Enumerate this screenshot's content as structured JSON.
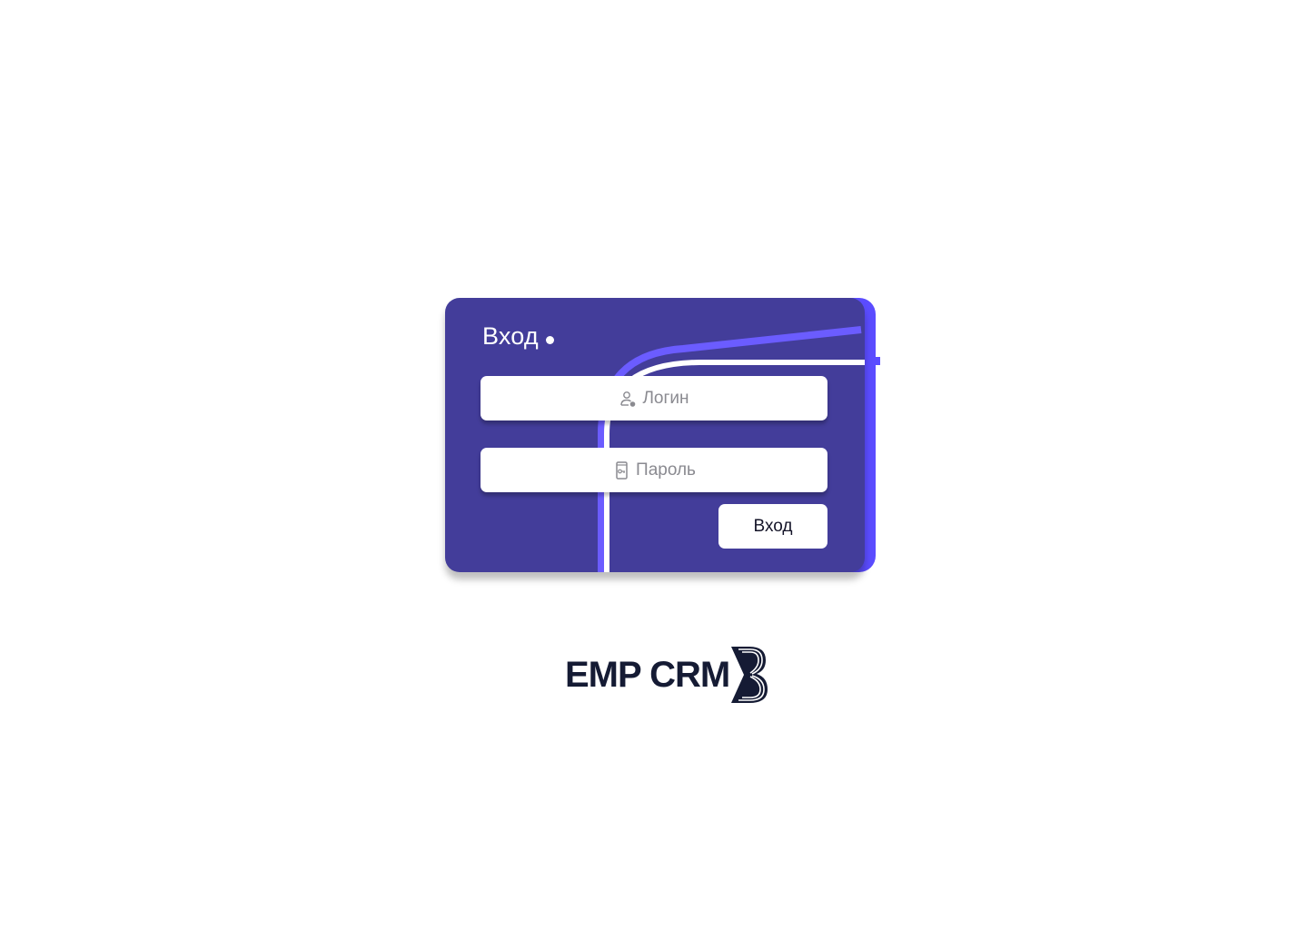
{
  "login_card": {
    "title": "Вход",
    "login_field": {
      "placeholder": "Логин",
      "icon": "user-icon"
    },
    "password_field": {
      "placeholder": "Пароль",
      "icon": "password-key-icon"
    },
    "submit_label": "Вход"
  },
  "brand": {
    "name": "EMP CRM",
    "mark_icon": "emp-crm-logo-mark"
  },
  "colors": {
    "page_background": "#ffffff",
    "card_background": "#433d9a",
    "card_accent": "#5b4cff",
    "line_light": "#6b5cff",
    "line_white": "#ffffff",
    "placeholder_text": "#8a8a90",
    "logo_text": "#151b34"
  }
}
